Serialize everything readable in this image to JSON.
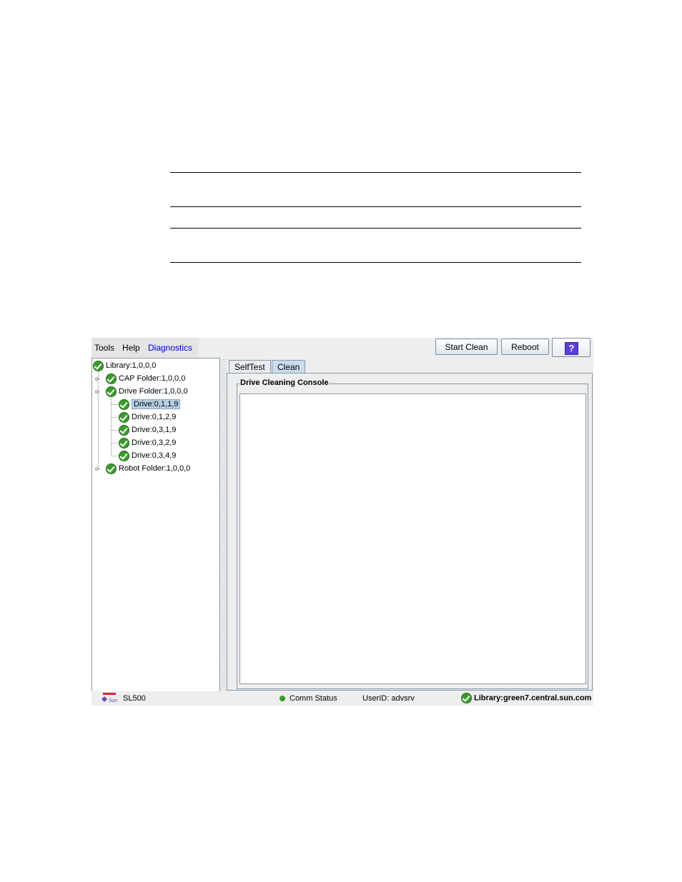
{
  "menubar": {
    "items": [
      "Tools",
      "Help",
      "Diagnostics"
    ],
    "active_color": "#0000cc"
  },
  "toolbar": {
    "start_clean_label": "Start Clean",
    "reboot_label": "Reboot",
    "help_glyph": "?"
  },
  "tree": {
    "nodes": [
      {
        "label": "Library:1,0,0,0",
        "status_icon": "green-check-icon"
      },
      {
        "label": "CAP Folder:1,0,0,0",
        "status_icon": "green-check-icon"
      },
      {
        "label": "Drive Folder:1,0,0,0",
        "status_icon": "green-check-icon"
      },
      {
        "label": "Drive:0,1,1,9",
        "status_icon": "green-check-icon",
        "selected": true
      },
      {
        "label": "Drive:0,1,2,9",
        "status_icon": "green-check-icon"
      },
      {
        "label": "Drive:0,3,1,9",
        "status_icon": "green-check-icon"
      },
      {
        "label": "Drive:0,3,2,9",
        "status_icon": "green-check-icon"
      },
      {
        "label": "Drive:0,3,4,9",
        "status_icon": "green-check-icon"
      },
      {
        "label": "Robot Folder:1,0,0,0",
        "status_icon": "green-check-icon"
      }
    ]
  },
  "tabs": [
    {
      "label": "SelfTest",
      "active": false
    },
    {
      "label": "Clean",
      "active": true
    }
  ],
  "console": {
    "title": "Drive Cleaning Console",
    "content": ""
  },
  "statusbar": {
    "product": "SL500",
    "logo_text": "Sun",
    "comm_status": "Comm Status",
    "user": "UserID: advsrv",
    "library": "Library:green7.central.sun.com",
    "status_color": "#3c9a2e"
  }
}
